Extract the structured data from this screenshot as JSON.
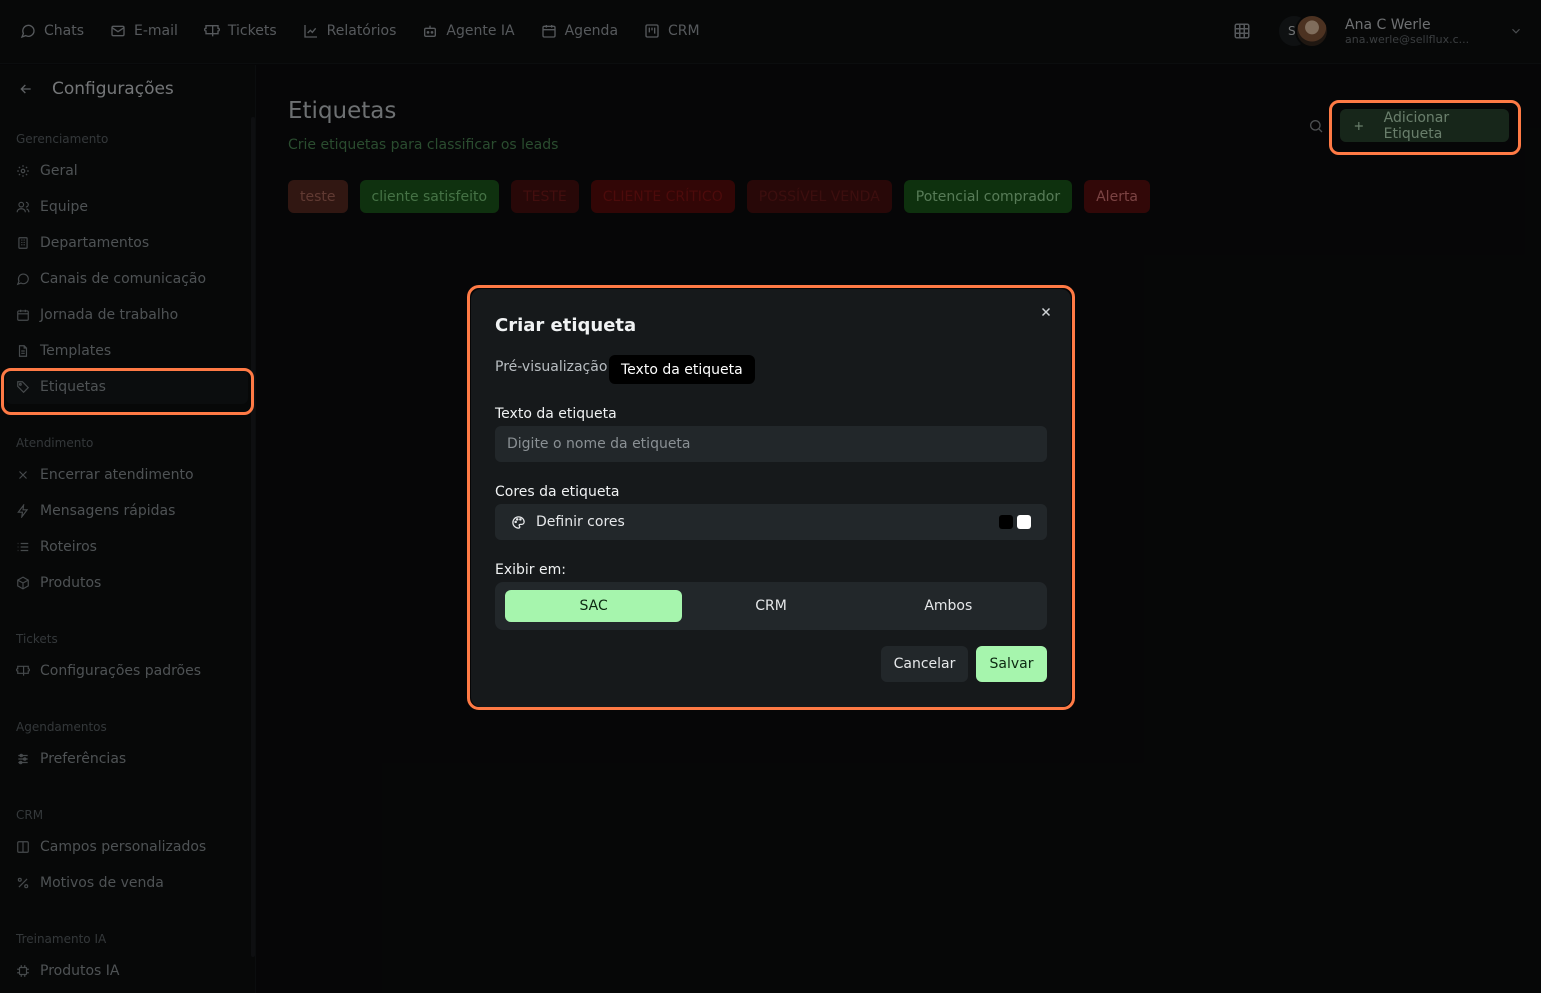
{
  "nav": {
    "items": [
      {
        "label": "Chats",
        "icon": "chat-bubble-icon"
      },
      {
        "label": "E-mail",
        "icon": "mail-icon"
      },
      {
        "label": "Tickets",
        "icon": "ticket-icon"
      },
      {
        "label": "Relatórios",
        "icon": "chart-line-icon"
      },
      {
        "label": "Agente IA",
        "icon": "robot-icon"
      },
      {
        "label": "Agenda",
        "icon": "calendar-icon"
      },
      {
        "label": "CRM",
        "icon": "kanban-icon"
      }
    ]
  },
  "user": {
    "initial": "S-",
    "name": "Ana C Werle",
    "email": "ana.werle@sellflux.c..."
  },
  "sidebar": {
    "title": "Configurações",
    "groups": [
      {
        "label": "Gerenciamento",
        "items": [
          "Geral",
          "Equipe",
          "Departamentos",
          "Canais de comunicação",
          "Jornada de trabalho",
          "Templates",
          "Etiquetas"
        ]
      },
      {
        "label": "Atendimento",
        "items": [
          "Encerrar atendimento",
          "Mensagens rápidas",
          "Roteiros",
          "Produtos"
        ]
      },
      {
        "label": "Tickets",
        "items": [
          "Configurações padrões"
        ]
      },
      {
        "label": "Agendamentos",
        "items": [
          "Preferências"
        ]
      },
      {
        "label": "CRM",
        "items": [
          "Campos personalizados",
          "Motivos de venda"
        ]
      },
      {
        "label": "Treinamento IA",
        "items": [
          "Produtos IA"
        ]
      }
    ],
    "active_item": "Etiquetas"
  },
  "main": {
    "title": "Etiquetas",
    "subtitle": "Crie etiquetas para classificar os leads",
    "add_button": "Adicionar Etiqueta",
    "tags": [
      {
        "label": "teste",
        "bg": "#5a2a22",
        "fg": "#b06a5c"
      },
      {
        "label": "cliente satisfeito",
        "bg": "#1c5a1c",
        "fg": "#7fd07f"
      },
      {
        "label": "TESTE",
        "bg": "#4a0f0f",
        "fg": "#7a1a1a"
      },
      {
        "label": "CLIENTE CRÍTICO",
        "bg": "#5c0b0b",
        "fg": "#8a1414"
      },
      {
        "label": "POSSÍVEL VENDA",
        "bg": "#4a1010",
        "fg": "#6e1a1a"
      },
      {
        "label": "Potencial comprador",
        "bg": "#1a5a1a",
        "fg": "#9fe09f"
      },
      {
        "label": "Alerta",
        "bg": "#5c0f0f",
        "fg": "#e07a7a"
      }
    ]
  },
  "modal": {
    "title": "Criar etiqueta",
    "preview_label": "Pré-visualização",
    "preview_text": "Texto da etiqueta",
    "text_label": "Texto da etiqueta",
    "text_placeholder": "Digite o nome da etiqueta",
    "text_value": "",
    "colors_label": "Cores da etiqueta",
    "colors_action": "Definir cores",
    "color_swatches": [
      "#000000",
      "#ffffff"
    ],
    "display_label": "Exibir em:",
    "display_options": [
      "SAC",
      "CRM",
      "Ambos"
    ],
    "display_selected": "SAC",
    "cancel": "Cancelar",
    "save": "Salvar"
  },
  "accent_color": "#a6f5ad",
  "highlight_color": "#ff7a45"
}
